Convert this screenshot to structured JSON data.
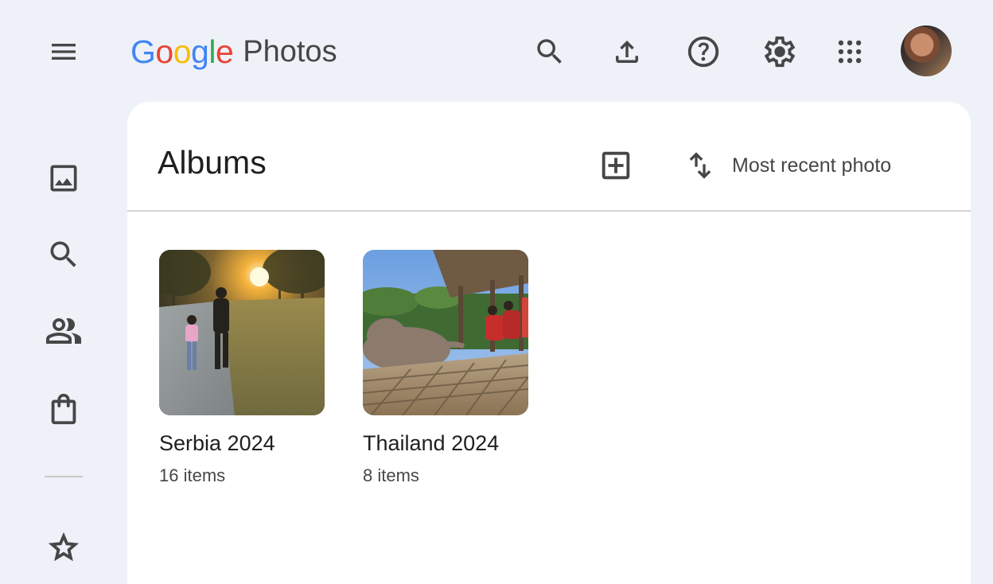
{
  "app": {
    "logo_google": "Google",
    "logo_product": "Photos",
    "brand_colors": {
      "blue": "#4285F4",
      "red": "#EA4335",
      "yellow": "#FBBC05",
      "green": "#34A853"
    }
  },
  "top_bar": {
    "actions": [
      {
        "id": "search",
        "icon": "search-icon"
      },
      {
        "id": "upload",
        "icon": "upload-icon"
      },
      {
        "id": "help",
        "icon": "help-icon"
      },
      {
        "id": "settings",
        "icon": "gear-icon"
      },
      {
        "id": "apps",
        "icon": "apps-grid-icon"
      }
    ],
    "avatar_icon": "account-avatar"
  },
  "left_rail": {
    "items": [
      {
        "id": "photos",
        "icon": "photo-icon"
      },
      {
        "id": "explore",
        "icon": "search-icon"
      },
      {
        "id": "sharing",
        "icon": "people-icon"
      },
      {
        "id": "print-store",
        "icon": "shopping-bag-icon"
      },
      {
        "id": "favorites",
        "icon": "star-icon"
      }
    ]
  },
  "main": {
    "title": "Albums",
    "new_album_icon": "add-box-icon",
    "sort": {
      "icon": "swap-vert-icon",
      "label": "Most recent photo"
    },
    "albums": [
      {
        "title": "Serbia 2024",
        "count": "16 items"
      },
      {
        "title": "Thailand 2024",
        "count": "8 items"
      }
    ]
  }
}
